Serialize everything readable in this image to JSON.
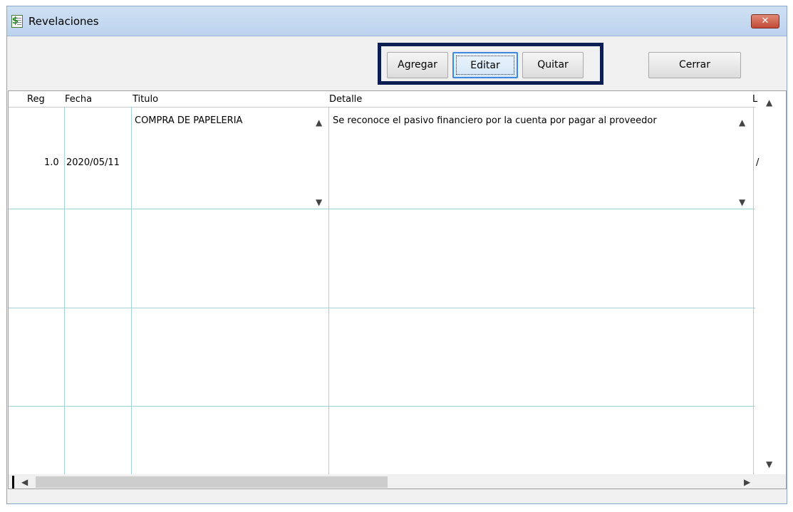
{
  "window": {
    "title": "Revelaciones",
    "close_glyph": "✕",
    "icon": "dollar-document-icon"
  },
  "toolbar": {
    "add_label": "Agregar",
    "edit_label": "Editar",
    "remove_label": "Quitar",
    "close_label": "Cerrar"
  },
  "grid": {
    "columns": [
      "Reg",
      "Fecha",
      "Titulo",
      "Detalle",
      "L"
    ],
    "rows": [
      {
        "reg": "1.0",
        "fecha": "2020/05/11",
        "titulo": "COMPRA DE PAPELERIA",
        "detalle": "Se reconoce el pasivo financiero por la cuenta por pagar al proveedor",
        "extra": "/"
      }
    ]
  },
  "colors": {
    "title_bar": "#bcd3ee",
    "close_button": "#c24a35",
    "highlight_border": "#0d1e52",
    "grid_lines": "#a8d0d8",
    "focus_border": "#3c8ae0"
  }
}
